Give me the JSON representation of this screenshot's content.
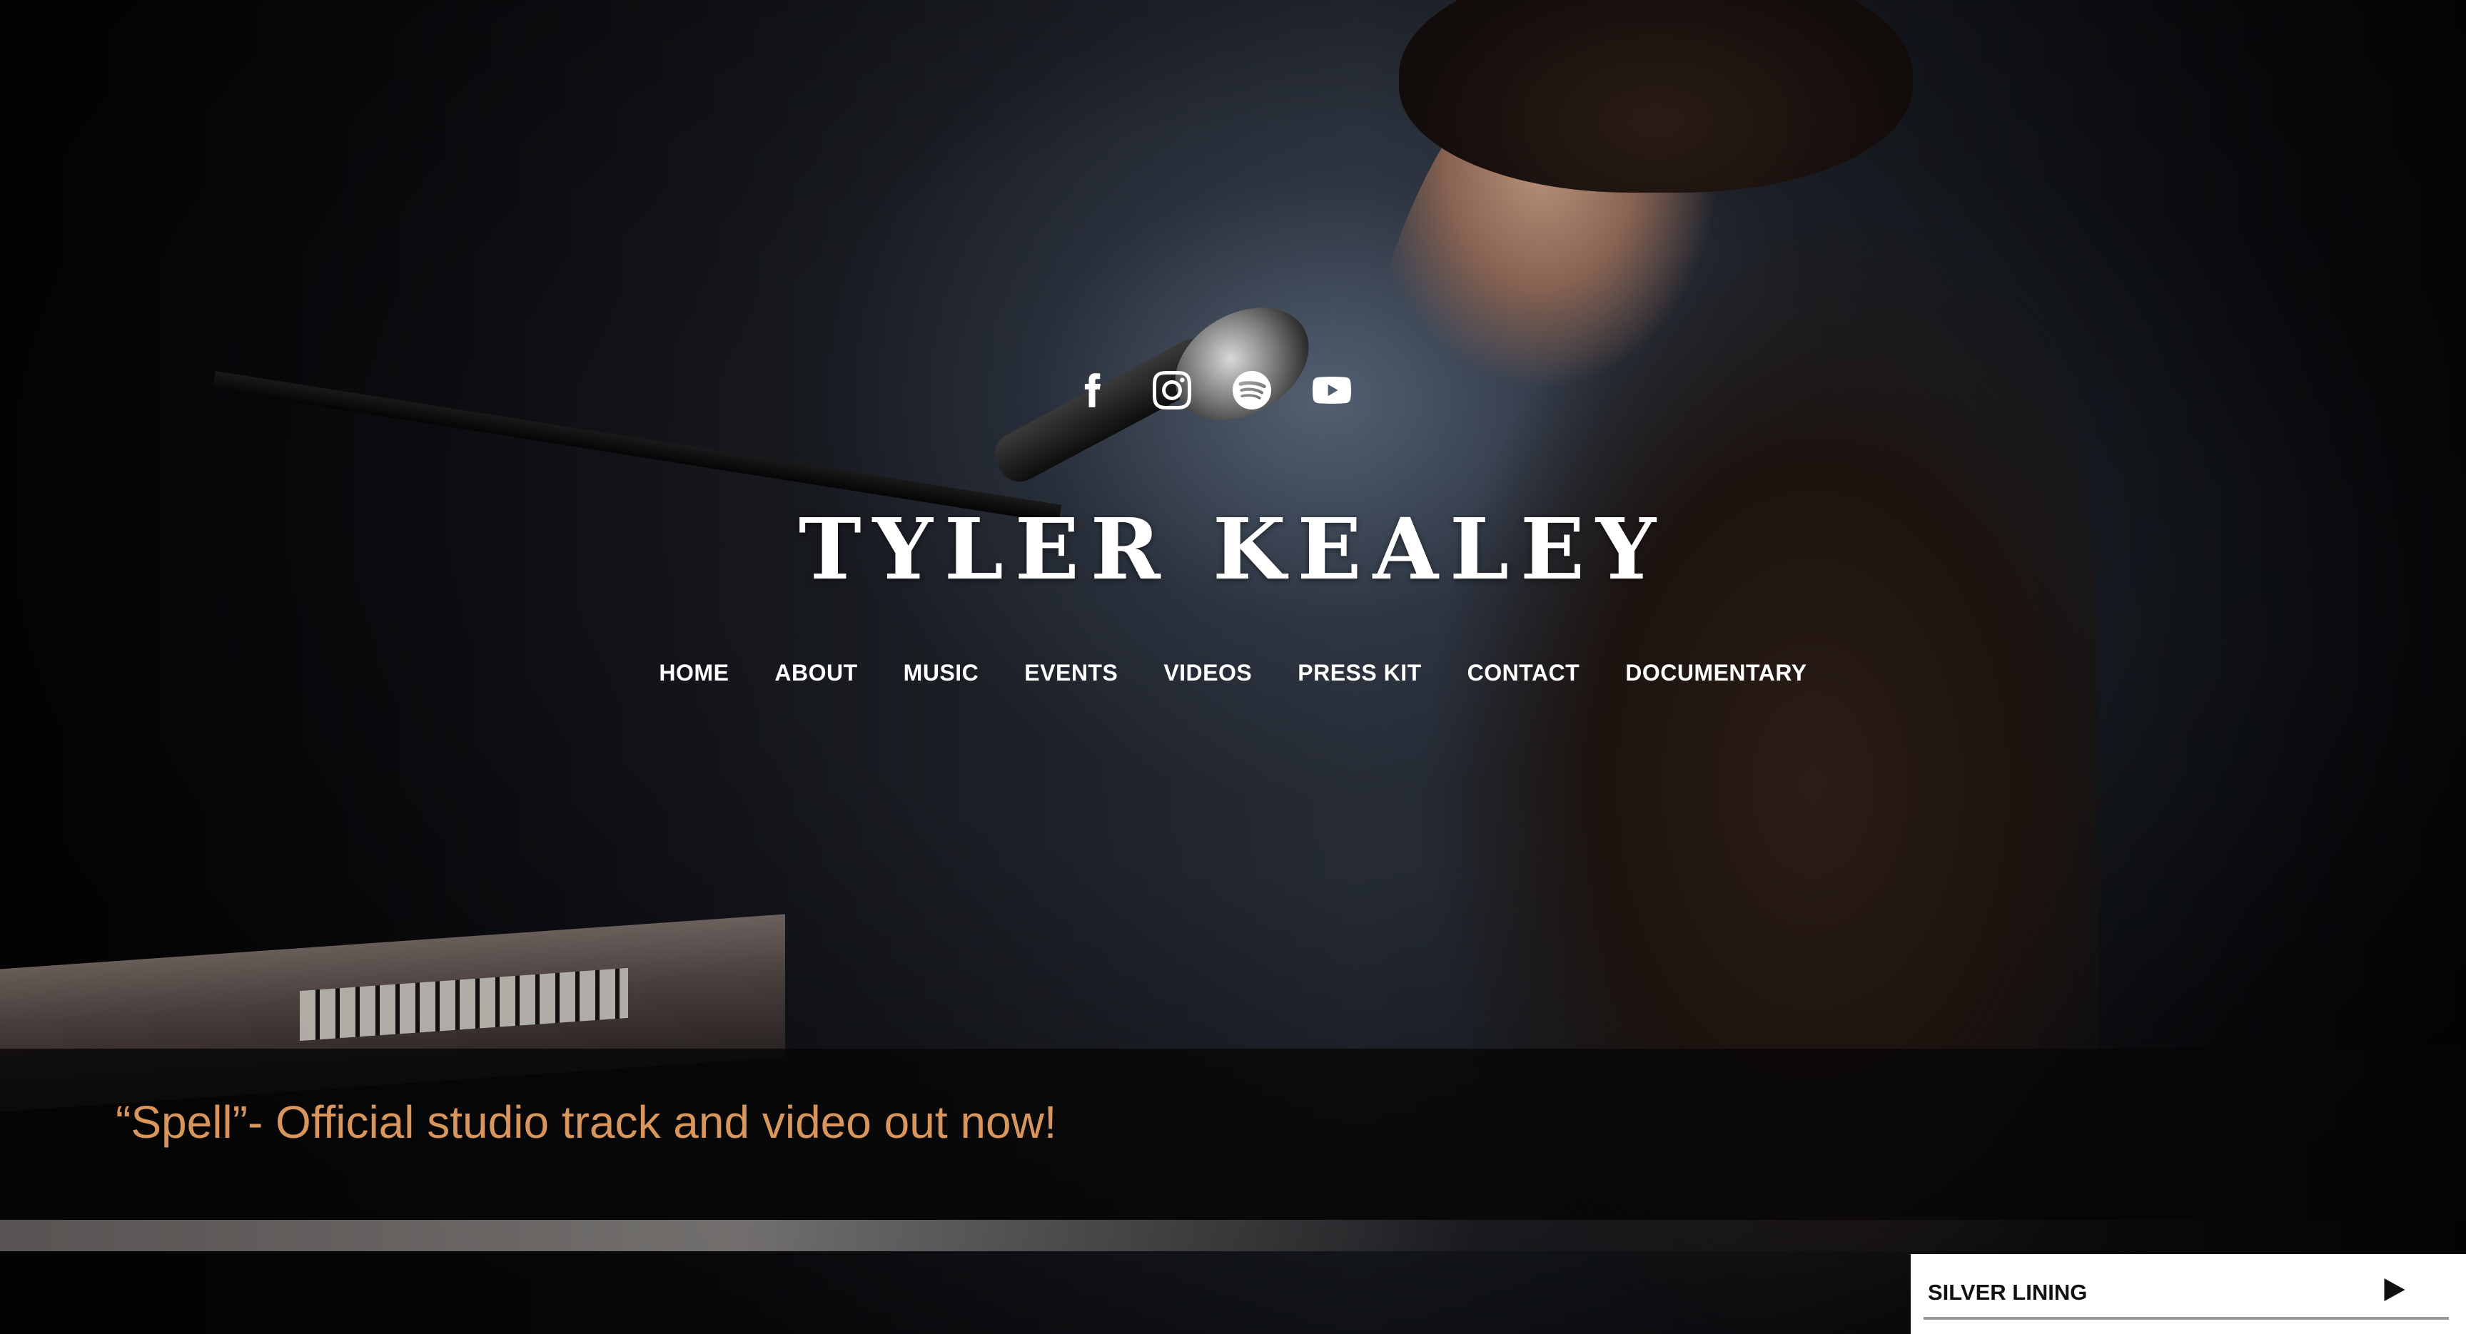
{
  "site": {
    "title": "TYLER KEALEY"
  },
  "social": [
    {
      "icon": "facebook-icon",
      "label": "Facebook"
    },
    {
      "icon": "instagram-icon",
      "label": "Instagram"
    },
    {
      "icon": "spotify-icon",
      "label": "Spotify"
    },
    {
      "icon": "youtube-icon",
      "label": "YouTube"
    }
  ],
  "nav": {
    "items": [
      {
        "label": "HOME"
      },
      {
        "label": "ABOUT"
      },
      {
        "label": "MUSIC"
      },
      {
        "label": "EVENTS"
      },
      {
        "label": "VIDEOS"
      },
      {
        "label": "PRESS KIT"
      },
      {
        "label": "CONTACT"
      },
      {
        "label": "DOCUMENTARY"
      }
    ]
  },
  "banner": {
    "headline": "“Spell”- Official studio track and video out now!"
  },
  "player": {
    "track_title": "SILVER LINING",
    "play_icon": "play-icon"
  },
  "colors": {
    "headline_accent": "#d9965c",
    "text": "#ffffff",
    "player_bg": "#ffffff"
  }
}
